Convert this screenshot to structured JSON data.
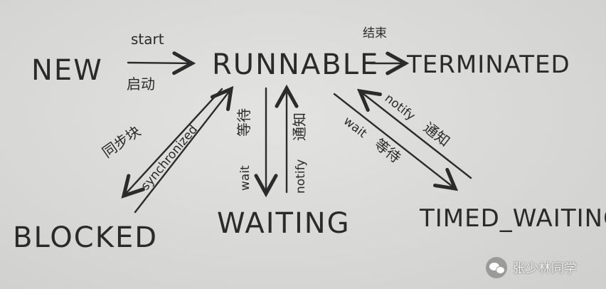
{
  "states": {
    "new": "NEW",
    "runnable": "RUNNABLE",
    "terminated": "TERMINATED",
    "blocked": "BLOCKED",
    "waiting": "WAITING",
    "timed_waiting": "TIMED_WAITING"
  },
  "transitions": {
    "start_en": "start",
    "start_cn": "启动",
    "end_cn": "结束",
    "synchronized_en": "synchronized",
    "synchronized_cn": "同步块",
    "wait_en": "wait",
    "wait_cn": "等待",
    "notify_en": "notify",
    "notify_cn": "通知",
    "timed_wait_en": "wait",
    "timed_wait_cn": "等待",
    "timed_notify_en": "notify",
    "timed_notify_cn": "通知"
  },
  "watermark": {
    "text": "张少林同学",
    "icon": "wechat-icon"
  }
}
